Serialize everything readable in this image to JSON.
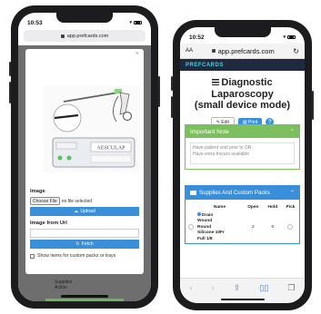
{
  "left": {
    "status": {
      "time": "10:53"
    },
    "url": "app.prefcards.com",
    "modal": {
      "close_label": "×",
      "device_brand": "AESCULAP",
      "image_label": "Image",
      "choose_file": "Choose File",
      "no_file": "no file selected",
      "upload_label": "Upload",
      "from_url_label": "Image from Url",
      "fetch_label": "Fetch",
      "custom_packs_label": "Show items for custom packs or trays"
    },
    "under_text": {
      "line1": "Supplies",
      "line2": "Action"
    }
  },
  "right": {
    "status": {
      "time": "10:52"
    },
    "browser": {
      "aa": "AA",
      "url": "app.prefcards.com"
    },
    "brand": "PREFCARDS",
    "title_line1": "Diagnostic Laparoscopy",
    "title_line2": "(small device mode)",
    "edit_label": "Edit",
    "print_label": "Print",
    "help_label": "?",
    "note": {
      "header": "Important Note",
      "text1": "Have patient void prior to OR",
      "text2": "Have extra trocars available"
    },
    "supplies": {
      "header": "Supplies And Custom Packs",
      "columns": [
        "Name",
        "Open",
        "Hold",
        "Pick"
      ],
      "rows": [
        {
          "name": [
            "Drain",
            "Wound",
            "Round",
            "Silicone 10Fr",
            "Full 1/8"
          ],
          "open": "2",
          "hold": "0"
        }
      ]
    }
  }
}
